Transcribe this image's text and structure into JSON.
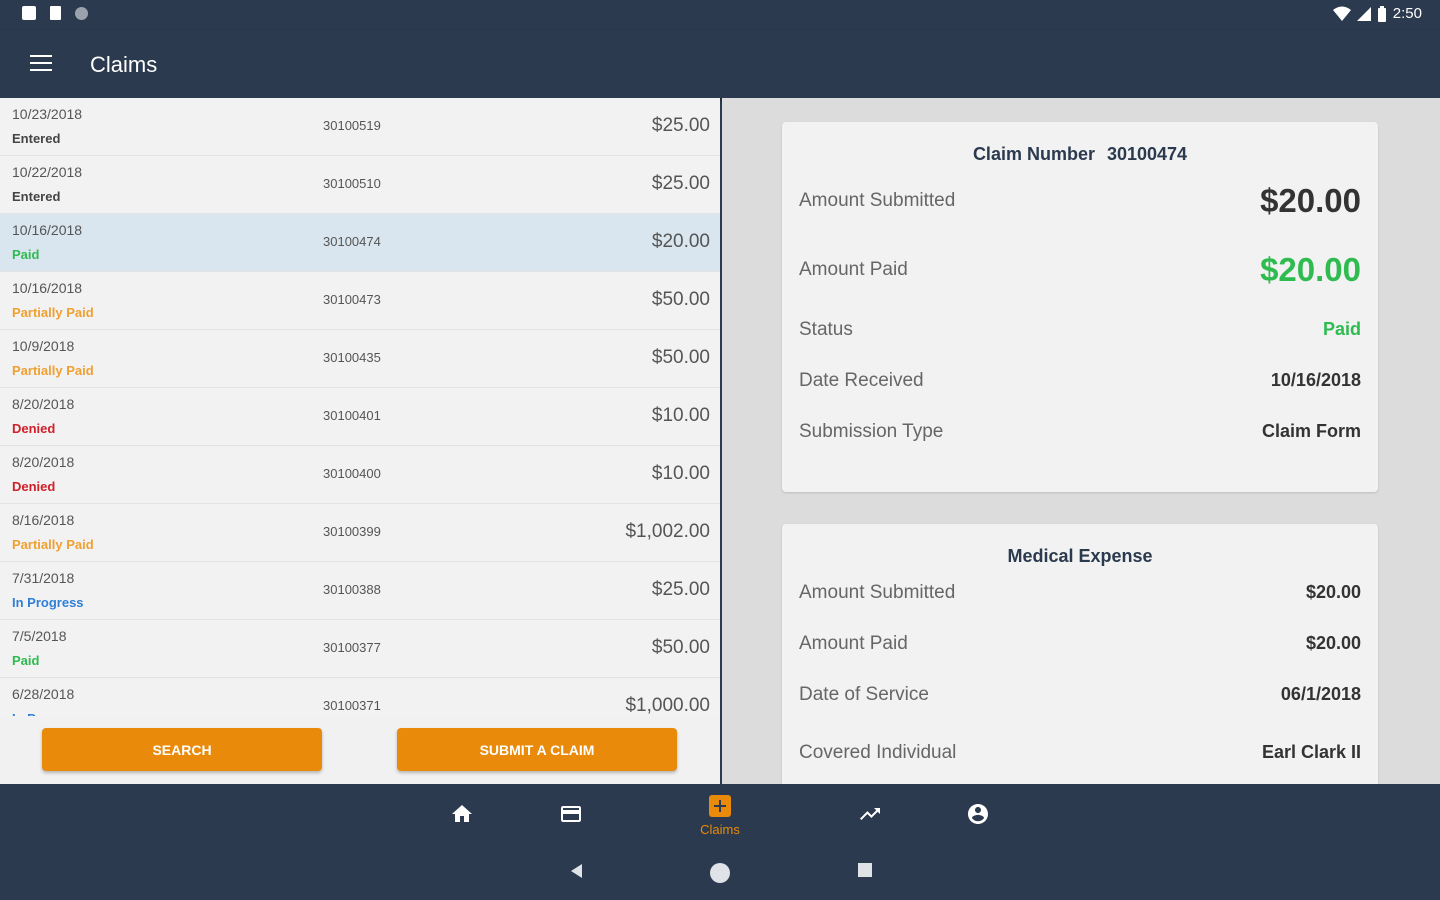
{
  "status_bar": {
    "time": "2:50"
  },
  "app_bar": {
    "title": "Claims"
  },
  "claims": [
    {
      "date": "10/23/2018",
      "status": "Entered",
      "status_color": "#444444",
      "number": "30100519",
      "amount": "$25.00"
    },
    {
      "date": "10/22/2018",
      "status": "Entered",
      "status_color": "#444444",
      "number": "30100510",
      "amount": "$25.00"
    },
    {
      "date": "10/16/2018",
      "status": "Paid",
      "status_color": "#2fbb4f",
      "number": "30100474",
      "amount": "$20.00",
      "selected": true
    },
    {
      "date": "10/16/2018",
      "status": "Partially Paid",
      "status_color": "#f0a030",
      "number": "30100473",
      "amount": "$50.00"
    },
    {
      "date": "10/9/2018",
      "status": "Partially Paid",
      "status_color": "#f0a030",
      "number": "30100435",
      "amount": "$50.00"
    },
    {
      "date": "8/20/2018",
      "status": "Denied",
      "status_color": "#d0202a",
      "number": "30100401",
      "amount": "$10.00"
    },
    {
      "date": "8/20/2018",
      "status": "Denied",
      "status_color": "#d0202a",
      "number": "30100400",
      "amount": "$10.00"
    },
    {
      "date": "8/16/2018",
      "status": "Partially Paid",
      "status_color": "#f0a030",
      "number": "30100399",
      "amount": "$1,002.00"
    },
    {
      "date": "7/31/2018",
      "status": "In Progress",
      "status_color": "#2f7fd8",
      "number": "30100388",
      "amount": "$25.00"
    },
    {
      "date": "7/5/2018",
      "status": "Paid",
      "status_color": "#2fbb4f",
      "number": "30100377",
      "amount": "$50.00"
    },
    {
      "date": "6/28/2018",
      "status": "In Progress",
      "status_color": "#2f7fd8",
      "number": "30100371",
      "amount": "$1,000.00"
    }
  ],
  "actions": {
    "search_label": "SEARCH",
    "submit_label": "SUBMIT A CLAIM"
  },
  "claim_detail": {
    "title_label": "Claim Number",
    "claim_number": "30100474",
    "amount_submitted_label": "Amount Submitted",
    "amount_submitted": "$20.00",
    "amount_paid_label": "Amount Paid",
    "amount_paid": "$20.00",
    "status_label": "Status",
    "status": "Paid",
    "date_received_label": "Date Received",
    "date_received": "10/16/2018",
    "submission_type_label": "Submission Type",
    "submission_type": "Claim Form"
  },
  "medical_expense": {
    "title": "Medical Expense",
    "amount_submitted_label": "Amount Submitted",
    "amount_submitted": "$20.00",
    "amount_paid_label": "Amount Paid",
    "amount_paid": "$20.00",
    "date_of_service_label": "Date of Service",
    "date_of_service": "06/1/2018",
    "covered_individual_label": "Covered Individual",
    "covered_individual": "Earl Clark II"
  },
  "bottom_nav": {
    "active_label": "Claims"
  },
  "colors": {
    "primary": "#2b3a4e",
    "accent": "#e98a0a",
    "green": "#2fbb4f"
  }
}
